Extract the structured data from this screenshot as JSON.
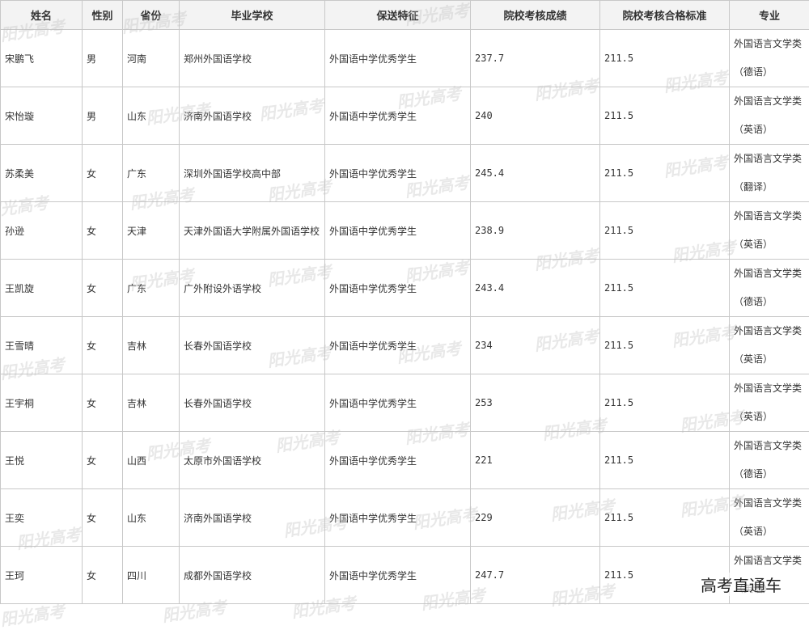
{
  "headers": {
    "name": "姓名",
    "gender": "性别",
    "province": "省份",
    "school": "毕业学校",
    "feature": "保送特征",
    "score": "院校考核成绩",
    "standard": "院校考核合格标准",
    "major": "专业"
  },
  "rows": [
    {
      "name": "宋鹏飞",
      "gender": "男",
      "province": "河南",
      "school": "郑州外国语学校",
      "feature": "外国语中学优秀学生",
      "score": "237.7",
      "standard": "211.5",
      "major_line1": "外国语言文学类",
      "major_line2": "（德语）"
    },
    {
      "name": "宋怡璇",
      "gender": "男",
      "province": "山东",
      "school": "济南外国语学校",
      "feature": "外国语中学优秀学生",
      "score": "240",
      "standard": "211.5",
      "major_line1": "外国语言文学类",
      "major_line2": "（英语）"
    },
    {
      "name": "苏柔美",
      "gender": "女",
      "province": "广东",
      "school": "深圳外国语学校高中部",
      "feature": "外国语中学优秀学生",
      "score": "245.4",
      "standard": "211.5",
      "major_line1": "外国语言文学类",
      "major_line2": "（翻译）"
    },
    {
      "name": "孙逊",
      "gender": "女",
      "province": "天津",
      "school": "天津外国语大学附属外国语学校",
      "feature": "外国语中学优秀学生",
      "score": "238.9",
      "standard": "211.5",
      "major_line1": "外国语言文学类",
      "major_line2": "（英语）"
    },
    {
      "name": "王凯旋",
      "gender": "女",
      "province": "广东",
      "school": "广外附设外语学校",
      "feature": "外国语中学优秀学生",
      "score": "243.4",
      "standard": "211.5",
      "major_line1": "外国语言文学类",
      "major_line2": "（德语）"
    },
    {
      "name": "王雪晴",
      "gender": "女",
      "province": "吉林",
      "school": "长春外国语学校",
      "feature": "外国语中学优秀学生",
      "score": "234",
      "standard": "211.5",
      "major_line1": "外国语言文学类",
      "major_line2": "（英语）"
    },
    {
      "name": "王宇桐",
      "gender": "女",
      "province": "吉林",
      "school": "长春外国语学校",
      "feature": "外国语中学优秀学生",
      "score": "253",
      "standard": "211.5",
      "major_line1": "外国语言文学类",
      "major_line2": "（英语）"
    },
    {
      "name": "王悦",
      "gender": "女",
      "province": "山西",
      "school": "太原市外国语学校",
      "feature": "外国语中学优秀学生",
      "score": "221",
      "standard": "211.5",
      "major_line1": "外国语言文学类",
      "major_line2": "（德语）"
    },
    {
      "name": "王奕",
      "gender": "女",
      "province": "山东",
      "school": "济南外国语学校",
      "feature": "外国语中学优秀学生",
      "score": "229",
      "standard": "211.5",
      "major_line1": "外国语言文学类",
      "major_line2": "（英语）"
    },
    {
      "name": "王珂",
      "gender": "女",
      "province": "四川",
      "school": "成都外国语学校",
      "feature": "外国语中学优秀学生",
      "score": "247.7",
      "standard": "211.5",
      "major_line1": "外国语言文学类",
      "major_line2": "（英语）"
    }
  ],
  "watermark": "阳光高考",
  "brand_overlay": "高考直通车"
}
